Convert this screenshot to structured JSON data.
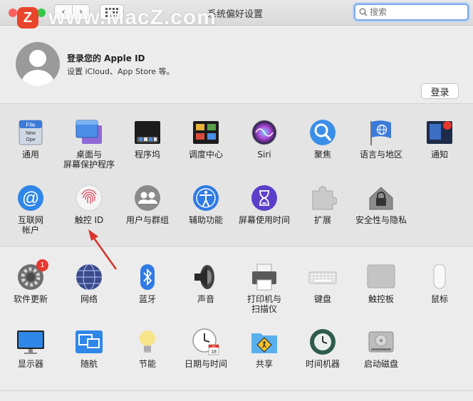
{
  "window": {
    "title": "系统偏好设置"
  },
  "toolbar": {
    "back": "‹",
    "forward": "›",
    "search_placeholder": "搜索"
  },
  "watermark": {
    "badge": "Z",
    "text": "www.MacZ.com"
  },
  "apple_id": {
    "title": "登录您的 Apple ID",
    "subtitle": "设置 iCloud、App Store 等。",
    "login_button": "登录"
  },
  "sections": {
    "row1": [
      {
        "label": "通用"
      },
      {
        "label": "桌面与\n屏幕保护程序"
      },
      {
        "label": "程序坞"
      },
      {
        "label": "调度中心"
      },
      {
        "label": "Siri"
      },
      {
        "label": "聚焦"
      },
      {
        "label": "语言与地区"
      },
      {
        "label": "通知"
      }
    ],
    "row2": [
      {
        "label": "互联网\n帐户"
      },
      {
        "label": "触控 ID"
      },
      {
        "label": "用户与群组"
      },
      {
        "label": "辅助功能"
      },
      {
        "label": "屏幕使用时间"
      },
      {
        "label": "扩展"
      },
      {
        "label": "安全性与隐私"
      }
    ],
    "row3": [
      {
        "label": "软件更新",
        "badge": "1"
      },
      {
        "label": "网络"
      },
      {
        "label": "蓝牙"
      },
      {
        "label": "声音"
      },
      {
        "label": "打印机与\n扫描仪"
      },
      {
        "label": "键盘"
      },
      {
        "label": "触控板"
      },
      {
        "label": "鼠标"
      }
    ],
    "row4": [
      {
        "label": "显示器"
      },
      {
        "label": "随航"
      },
      {
        "label": "节能"
      },
      {
        "label": "日期与时间"
      },
      {
        "label": "共享"
      },
      {
        "label": "时间机器"
      },
      {
        "label": "启动磁盘"
      }
    ]
  },
  "icons": {
    "file_text_1": "File",
    "file_text_2": "New",
    "file_text_3": "Ope",
    "calendar_month": "JUL",
    "calendar_day": "18"
  },
  "colors": {
    "accent": "#2f7ae5",
    "badge": "#e6372e",
    "arrow": "#d9322a"
  }
}
